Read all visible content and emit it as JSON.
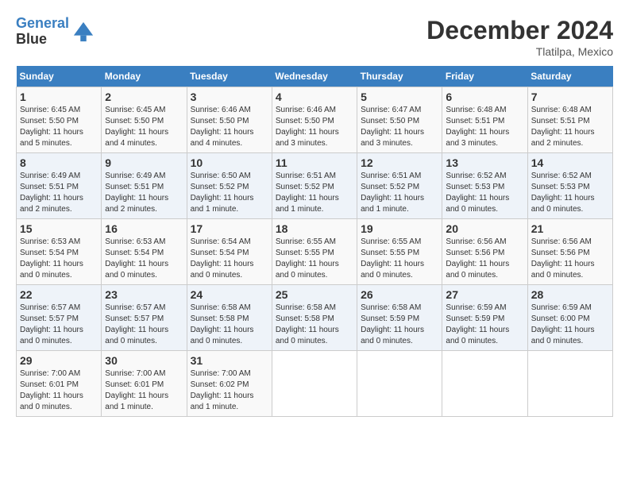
{
  "logo": {
    "line1": "General",
    "line2": "Blue"
  },
  "title": "December 2024",
  "subtitle": "Tlatilpa, Mexico",
  "days_of_week": [
    "Sunday",
    "Monday",
    "Tuesday",
    "Wednesday",
    "Thursday",
    "Friday",
    "Saturday"
  ],
  "weeks": [
    [
      {
        "day": "1",
        "sunrise": "6:45 AM",
        "sunset": "5:50 PM",
        "daylight": "11 hours and 5 minutes."
      },
      {
        "day": "2",
        "sunrise": "6:45 AM",
        "sunset": "5:50 PM",
        "daylight": "11 hours and 4 minutes."
      },
      {
        "day": "3",
        "sunrise": "6:46 AM",
        "sunset": "5:50 PM",
        "daylight": "11 hours and 4 minutes."
      },
      {
        "day": "4",
        "sunrise": "6:46 AM",
        "sunset": "5:50 PM",
        "daylight": "11 hours and 3 minutes."
      },
      {
        "day": "5",
        "sunrise": "6:47 AM",
        "sunset": "5:50 PM",
        "daylight": "11 hours and 3 minutes."
      },
      {
        "day": "6",
        "sunrise": "6:48 AM",
        "sunset": "5:51 PM",
        "daylight": "11 hours and 3 minutes."
      },
      {
        "day": "7",
        "sunrise": "6:48 AM",
        "sunset": "5:51 PM",
        "daylight": "11 hours and 2 minutes."
      }
    ],
    [
      {
        "day": "8",
        "sunrise": "6:49 AM",
        "sunset": "5:51 PM",
        "daylight": "11 hours and 2 minutes."
      },
      {
        "day": "9",
        "sunrise": "6:49 AM",
        "sunset": "5:51 PM",
        "daylight": "11 hours and 2 minutes."
      },
      {
        "day": "10",
        "sunrise": "6:50 AM",
        "sunset": "5:52 PM",
        "daylight": "11 hours and 1 minute."
      },
      {
        "day": "11",
        "sunrise": "6:51 AM",
        "sunset": "5:52 PM",
        "daylight": "11 hours and 1 minute."
      },
      {
        "day": "12",
        "sunrise": "6:51 AM",
        "sunset": "5:52 PM",
        "daylight": "11 hours and 1 minute."
      },
      {
        "day": "13",
        "sunrise": "6:52 AM",
        "sunset": "5:53 PM",
        "daylight": "11 hours and 0 minutes."
      },
      {
        "day": "14",
        "sunrise": "6:52 AM",
        "sunset": "5:53 PM",
        "daylight": "11 hours and 0 minutes."
      }
    ],
    [
      {
        "day": "15",
        "sunrise": "6:53 AM",
        "sunset": "5:54 PM",
        "daylight": "11 hours and 0 minutes."
      },
      {
        "day": "16",
        "sunrise": "6:53 AM",
        "sunset": "5:54 PM",
        "daylight": "11 hours and 0 minutes."
      },
      {
        "day": "17",
        "sunrise": "6:54 AM",
        "sunset": "5:54 PM",
        "daylight": "11 hours and 0 minutes."
      },
      {
        "day": "18",
        "sunrise": "6:55 AM",
        "sunset": "5:55 PM",
        "daylight": "11 hours and 0 minutes."
      },
      {
        "day": "19",
        "sunrise": "6:55 AM",
        "sunset": "5:55 PM",
        "daylight": "11 hours and 0 minutes."
      },
      {
        "day": "20",
        "sunrise": "6:56 AM",
        "sunset": "5:56 PM",
        "daylight": "11 hours and 0 minutes."
      },
      {
        "day": "21",
        "sunrise": "6:56 AM",
        "sunset": "5:56 PM",
        "daylight": "11 hours and 0 minutes."
      }
    ],
    [
      {
        "day": "22",
        "sunrise": "6:57 AM",
        "sunset": "5:57 PM",
        "daylight": "11 hours and 0 minutes."
      },
      {
        "day": "23",
        "sunrise": "6:57 AM",
        "sunset": "5:57 PM",
        "daylight": "11 hours and 0 minutes."
      },
      {
        "day": "24",
        "sunrise": "6:58 AM",
        "sunset": "5:58 PM",
        "daylight": "11 hours and 0 minutes."
      },
      {
        "day": "25",
        "sunrise": "6:58 AM",
        "sunset": "5:58 PM",
        "daylight": "11 hours and 0 minutes."
      },
      {
        "day": "26",
        "sunrise": "6:58 AM",
        "sunset": "5:59 PM",
        "daylight": "11 hours and 0 minutes."
      },
      {
        "day": "27",
        "sunrise": "6:59 AM",
        "sunset": "5:59 PM",
        "daylight": "11 hours and 0 minutes."
      },
      {
        "day": "28",
        "sunrise": "6:59 AM",
        "sunset": "6:00 PM",
        "daylight": "11 hours and 0 minutes."
      }
    ],
    [
      {
        "day": "29",
        "sunrise": "7:00 AM",
        "sunset": "6:01 PM",
        "daylight": "11 hours and 0 minutes."
      },
      {
        "day": "30",
        "sunrise": "7:00 AM",
        "sunset": "6:01 PM",
        "daylight": "11 hours and 1 minute."
      },
      {
        "day": "31",
        "sunrise": "7:00 AM",
        "sunset": "6:02 PM",
        "daylight": "11 hours and 1 minute."
      },
      null,
      null,
      null,
      null
    ]
  ],
  "labels": {
    "sunrise": "Sunrise:",
    "sunset": "Sunset:",
    "daylight": "Daylight:"
  }
}
